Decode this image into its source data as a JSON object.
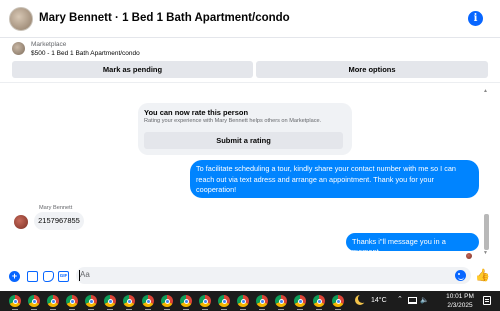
{
  "header": {
    "title": "Mary Bennett · 1 Bed 1 Bath Apartment/condo",
    "info_icon": "info-icon",
    "info_glyph": "i"
  },
  "listing": {
    "source": "Marketplace",
    "item": "$500 - 1 Bed 1 Bath Apartment/condo",
    "mark_pending_label": "Mark as pending",
    "more_options_label": "More options"
  },
  "rating_card": {
    "title": "You can now rate this person",
    "subtitle": "Rating your experience with Mary Bennett helps others on Marketplace.",
    "button_label": "Submit a rating"
  },
  "messages": [
    {
      "direction": "outgoing",
      "text": "To facilitate scheduling a tour, kindly share your contact number with me so I can reach out via text adress and arrange an appointment. Thank you for your cooperation!"
    },
    {
      "direction": "incoming",
      "sender": "Mary Bennett",
      "text": "2157967855"
    },
    {
      "direction": "outgoing",
      "text": "Thanks i\"ll message you in a moment"
    }
  ],
  "composer": {
    "placeholder": "Aa",
    "plus_glyph": "+",
    "gif_label": "GIF",
    "like_glyph": "👍",
    "icons": [
      "plus-icon",
      "image-icon",
      "sticker-icon",
      "gif-icon",
      "emoji-icon",
      "like-icon"
    ]
  },
  "taskbar": {
    "temperature": "14°C",
    "time": "10:01 PM",
    "date": "2/3/2025",
    "chevron_glyph": "⌃",
    "speaker_glyph": "🔈",
    "app_icon": "chrome-icon"
  },
  "colors": {
    "accent": "#0084ff",
    "brand_blue": "#0866ff",
    "bubble_gray": "#f0f2f5",
    "button_gray": "#e4e6eb",
    "taskbar": "#1c1c1c"
  }
}
